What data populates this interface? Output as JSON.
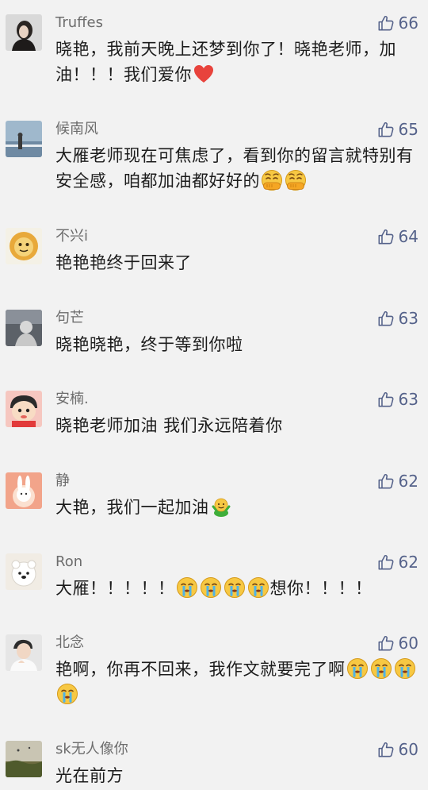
{
  "comments": [
    {
      "user": "Truffes",
      "likes": "66",
      "text": "晓艳，我前天晚上还梦到你了！晓艳老师，加油！！！我们爱你"
    },
    {
      "user": "候南风",
      "likes": "65",
      "text": "大雁老师现在可焦虑了，看到你的留言就特别有安全感，咱都加油都好好的"
    },
    {
      "user": "不兴i",
      "likes": "64",
      "text": "艳艳艳终于回来了"
    },
    {
      "user": "句芒",
      "likes": "63",
      "text": "晓艳晓艳，终于等到你啦"
    },
    {
      "user": "安楠.",
      "likes": "63",
      "text": "晓艳老师加油 我们永远陪着你"
    },
    {
      "user": "静",
      "likes": "62",
      "text": "大艳，我们一起加油"
    },
    {
      "user": "Ron",
      "likes": "62",
      "text_a": "大雁！！！！！",
      "text_b": "想你！！！！"
    },
    {
      "user": "北念",
      "likes": "60",
      "text": "艳啊，你再不回来，我作文就要完了啊"
    },
    {
      "user": "sk无人像你",
      "likes": "60",
      "text": "光在前方"
    }
  ],
  "icons": {
    "like": "thumbs-up-icon",
    "heart": "red-heart-emoji",
    "shush": "shushing-face-emoji",
    "cry": "crying-face-emoji",
    "cheer": "cheering-emoji"
  },
  "colors": {
    "background": "#f2f2f2",
    "username": "#6d6d6d",
    "likes": "#55628a",
    "text": "#1c1c1c"
  }
}
